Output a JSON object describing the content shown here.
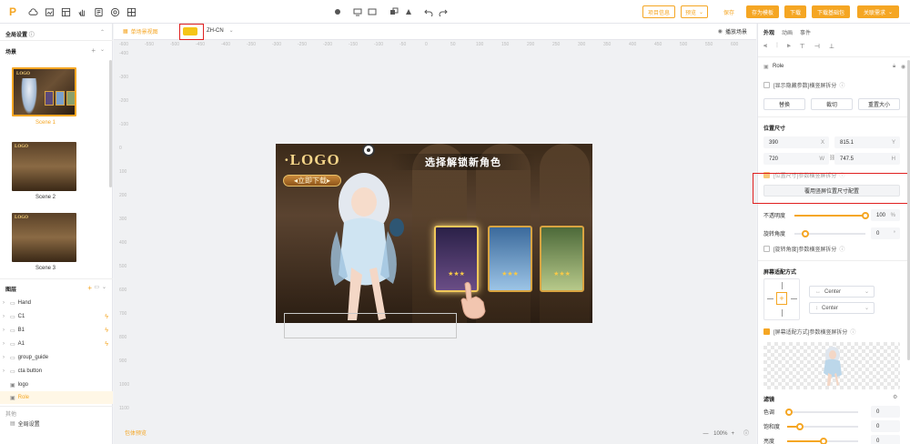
{
  "toolbar": {
    "btn_project_info": "项目信息",
    "btn_preview": "预览",
    "btn_save": "保存",
    "btn_save_template": "存为模板",
    "btn_download": "下载",
    "btn_download_base": "下载基础包",
    "btn_close_required": "关联需求"
  },
  "left": {
    "global_settings": "全局设置",
    "scenes_title": "场景",
    "scenes": [
      "Scene 1",
      "Scene 2",
      "Scene 3"
    ],
    "layers_title": "图层",
    "layers": [
      "Hand",
      "C1",
      "B1",
      "A1",
      "group_guide",
      "cta button",
      "logo",
      "Role"
    ],
    "assets_title": "其他",
    "global_setting_item": "全局设置"
  },
  "canvas": {
    "tab_single_scene": "单场景视图",
    "lang": "ZH-CN",
    "play_scene": "播放场景",
    "bottom_hint": "包体预览",
    "zoom": "100%",
    "ruler_h": [
      "-600",
      "-550",
      "-500",
      "-450",
      "-400",
      "-350",
      "-300",
      "-250",
      "-200",
      "-150",
      "-100",
      "-50",
      "0",
      "50",
      "100",
      "150",
      "200",
      "250",
      "300",
      "350",
      "400",
      "450",
      "500",
      "550",
      "600"
    ],
    "ruler_v": [
      "-400",
      "-300",
      "-200",
      "-100",
      "0",
      "100",
      "200",
      "300",
      "400",
      "500",
      "600",
      "700",
      "800",
      "900",
      "1000",
      "1100"
    ],
    "scene": {
      "logo": "·LOGO",
      "cta": "◂立即下载▸",
      "title": "选择解锁新角色",
      "stars": "★★★"
    }
  },
  "right": {
    "tabs": [
      "外观",
      "动画",
      "事件"
    ],
    "node_name": "Role",
    "hide_param_checkbox": "[显示隐藏参数]横竖屏拆分",
    "btn_replace": "替换",
    "btn_crop": "裁切",
    "btn_reset_size": "重置大小",
    "pos_size_title": "位置尺寸",
    "x": "390",
    "y": "815.1",
    "w": "720",
    "h": "747.5",
    "x_label": "X",
    "y_label": "Y",
    "w_label": "W",
    "h_label": "H",
    "pos_checkbox": "[位置尺寸]参数横竖屏拆分",
    "btn_apply_vertical": "覆用竖屏位置尺寸配置",
    "opacity_label": "不透明度",
    "opacity_value": "100",
    "opacity_unit": "%",
    "rotation_label": "旋转角度",
    "rotation_value": "0",
    "rotation_unit": "°",
    "rotation_checkbox": "[旋转角度]参数横竖屏拆分",
    "fit_title": "屏幕适配方式",
    "fit_h": "Center",
    "fit_v": "Center",
    "fit_checkbox": "[屏幕适配方式]参数横竖屏拆分",
    "filter_title": "滤镜",
    "hue_label": "色调",
    "hue_value": "0",
    "sat_label": "饱和度",
    "sat_value": "0",
    "bright_label": "亮度",
    "bright_value": "0"
  },
  "colors": {
    "accent": "#f5a623",
    "highlight": "#e02020"
  }
}
